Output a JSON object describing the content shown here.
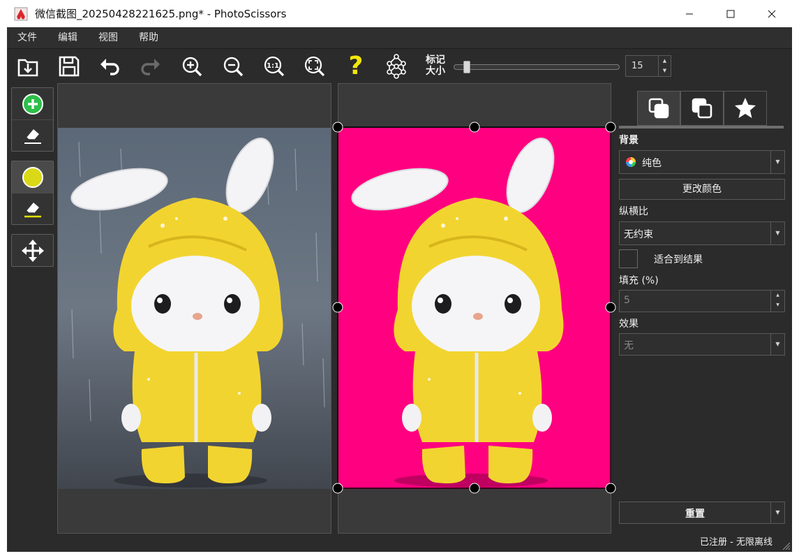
{
  "window": {
    "title": "微信截图_20250428221625.png* - PhotoScissors",
    "minimize_icon": "minimize-icon",
    "maximize_icon": "maximize-icon",
    "close_icon": "close-icon"
  },
  "menu": {
    "items": [
      {
        "label": "文件"
      },
      {
        "label": "编辑"
      },
      {
        "label": "视图"
      },
      {
        "label": "帮助"
      }
    ]
  },
  "toolbar": {
    "buttons": [
      {
        "name": "open",
        "icon": "open-download-icon"
      },
      {
        "name": "save",
        "icon": "save-icon"
      },
      {
        "name": "undo",
        "icon": "undo-icon"
      },
      {
        "name": "redo",
        "icon": "redo-icon"
      },
      {
        "name": "zoom-in",
        "icon": "zoom-in-icon"
      },
      {
        "name": "zoom-out",
        "icon": "zoom-out-icon"
      },
      {
        "name": "actual-size",
        "icon": "zoom-1-1-icon",
        "text": "1:1"
      },
      {
        "name": "fit",
        "icon": "zoom-fit-icon"
      },
      {
        "name": "help",
        "icon": "help-icon",
        "text": "?"
      },
      {
        "name": "network",
        "icon": "network-icon"
      }
    ],
    "marker_label_line1": "标记",
    "marker_label_line2": "大小",
    "marker_size_value": "15",
    "marker_slider_level": 0.06
  },
  "left_tools": {
    "groups": [
      {
        "items": [
          {
            "name": "add-marker",
            "icon": "plus-circle-icon"
          },
          {
            "name": "erase-foreground",
            "icon": "eraser-icon"
          }
        ]
      },
      {
        "items": [
          {
            "name": "background-marker",
            "icon": "yellow-circle-icon"
          },
          {
            "name": "erase-background",
            "icon": "eraser-yellow-icon"
          }
        ]
      },
      {
        "items": [
          {
            "name": "move",
            "icon": "move-arrows-icon"
          }
        ]
      }
    ]
  },
  "right_panel": {
    "tabs": [
      {
        "name": "background-tab",
        "icon": "layers-front-icon",
        "active": true
      },
      {
        "name": "foreground-tab",
        "icon": "layers-back-icon",
        "active": false
      },
      {
        "name": "effects-tab",
        "icon": "star-icon",
        "active": false
      }
    ],
    "background_label": "背景",
    "background_type": "纯色",
    "change_color_button": "更改颜色",
    "aspect_label": "纵横比",
    "aspect_value": "无约束",
    "fit_result_label": "适合到结果",
    "padding_label": "填充 (%)",
    "padding_value": "5",
    "effect_label": "效果",
    "effect_value": "无",
    "reset_button": "重置",
    "status": "已注册 - 无限离线"
  },
  "colors": {
    "result_background": "#ff0080",
    "accent_green": "#22c55e",
    "accent_yellow": "#d9d918"
  }
}
